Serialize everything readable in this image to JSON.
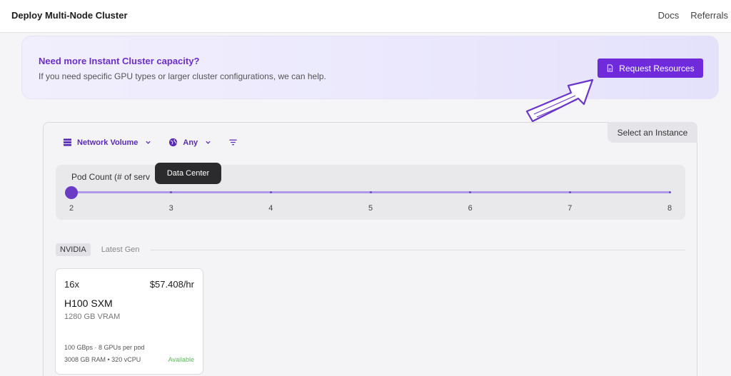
{
  "header": {
    "title": "Deploy Multi-Node Cluster",
    "nav": [
      "Docs",
      "Referrals"
    ]
  },
  "banner": {
    "heading": "Need more Instant Cluster capacity?",
    "subtext": "If you need specific GPU types or larger cluster configurations, we can help.",
    "button_label": "Request Resources"
  },
  "panel": {
    "select_instance_label": "Select an Instance"
  },
  "filters": {
    "network_volume": "Network Volume",
    "data_center": "Any"
  },
  "tooltip": "Data Center",
  "slider": {
    "label": "Pod Count (# of serv",
    "ticks": [
      "2",
      "3",
      "4",
      "5",
      "6",
      "7",
      "8"
    ],
    "value": 2,
    "min": 2,
    "max": 8
  },
  "gpu_tabs": {
    "active": "NVIDIA",
    "other": "Latest Gen"
  },
  "card": {
    "count": "16x",
    "price": "$57.408/hr",
    "gpu": "H100 SXM",
    "vram": "1280 GB VRAM",
    "spec1": "100 GBps · 8 GPUs per pod",
    "spec2": "3008 GB RAM  •  320 vCPU",
    "status": "Available"
  },
  "colors": {
    "accent": "#6f2bdb",
    "available": "#5cb85c"
  }
}
